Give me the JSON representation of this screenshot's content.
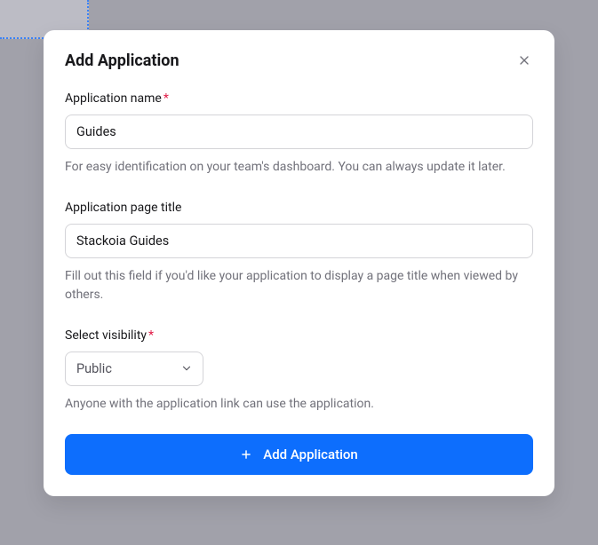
{
  "modal": {
    "title": "Add Application",
    "fields": {
      "name": {
        "label": "Application name",
        "required_marker": "*",
        "value": "Guides",
        "help": "For easy identification on your team's dashboard. You can always update it later."
      },
      "page_title": {
        "label": "Application page title",
        "value": "Stackoia Guides",
        "help": "Fill out this field if you'd like your application to display a page title when viewed by others."
      },
      "visibility": {
        "label": "Select visibility",
        "required_marker": "*",
        "value": "Public",
        "help": "Anyone with the application link can use the application."
      }
    },
    "submit_label": "Add Application"
  }
}
